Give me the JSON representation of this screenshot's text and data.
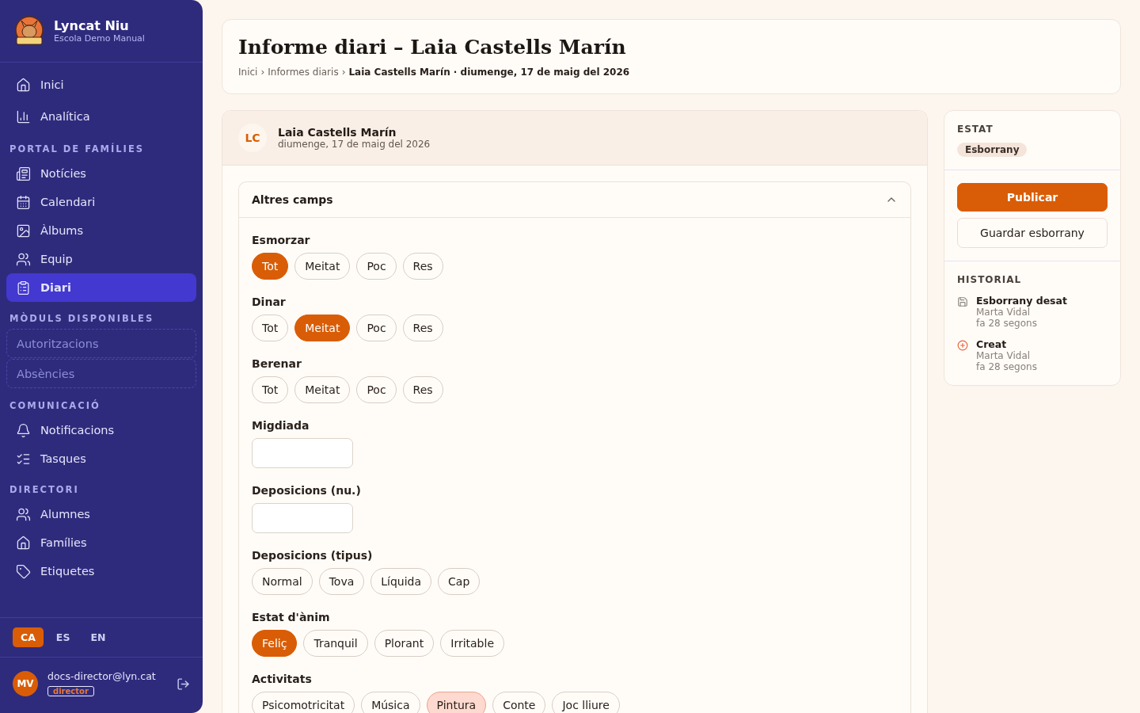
{
  "brand": {
    "name": "Lyncat Niu",
    "school": "Escola Demo Manual"
  },
  "sidebar": {
    "sections": [
      {
        "items": [
          {
            "label": "Inici",
            "selected": false,
            "kind": "link"
          },
          {
            "label": "Analítica",
            "selected": false,
            "kind": "link"
          }
        ]
      },
      {
        "title": "PORTAL DE FAMÍLIES",
        "items": [
          {
            "label": "Notícies",
            "selected": false,
            "kind": "link"
          },
          {
            "label": "Calendari",
            "selected": false,
            "kind": "link"
          },
          {
            "label": "Àlbums",
            "selected": false,
            "kind": "link"
          },
          {
            "label": "Equip",
            "selected": false,
            "kind": "link"
          },
          {
            "label": "Diari",
            "selected": true,
            "kind": "link"
          }
        ]
      },
      {
        "title": "MÒDULS DISPONIBLES",
        "items": [
          {
            "label": "Autoritzacions",
            "selected": false,
            "kind": "available"
          },
          {
            "label": "Absències",
            "selected": false,
            "kind": "available"
          }
        ]
      },
      {
        "title": "COMUNICACIÓ",
        "items": [
          {
            "label": "Notificacions",
            "selected": false,
            "kind": "link"
          },
          {
            "label": "Tasques",
            "selected": false,
            "kind": "link"
          }
        ]
      },
      {
        "title": "DIRECTORI",
        "items": [
          {
            "label": "Alumnes",
            "selected": false,
            "kind": "link"
          },
          {
            "label": "Famílies",
            "selected": false,
            "kind": "link"
          },
          {
            "label": "Etiquetes",
            "selected": false,
            "kind": "link"
          }
        ]
      }
    ],
    "languages": [
      {
        "label": "CA",
        "selected": true
      },
      {
        "label": "ES",
        "selected": false
      },
      {
        "label": "EN",
        "selected": false
      }
    ],
    "user": {
      "initials": "MV",
      "email": "docs-director@lyn.cat",
      "role": "director"
    }
  },
  "header": {
    "title": "Informe diari – Laia Castells Marín",
    "breadcrumbs": [
      {
        "label": "Inici",
        "separator": "›"
      },
      {
        "label": "Informes diaris",
        "separator": "›"
      }
    ],
    "current": "Laia Castells Marín · diumenge, 17 de maig del 2026"
  },
  "student": {
    "initials": "LC",
    "name": "Laia Castells Marín",
    "date": "diumenge, 17 de maig del 2026"
  },
  "section": {
    "title": "Altres camps",
    "expanded": true,
    "fields": [
      {
        "label": "Esmorzar",
        "kind": "choice",
        "options": [
          {
            "label": "Tot",
            "selected": true
          },
          {
            "label": "Meitat",
            "selected": false
          },
          {
            "label": "Poc",
            "selected": false
          },
          {
            "label": "Res",
            "selected": false
          }
        ]
      },
      {
        "label": "Dinar",
        "kind": "choice",
        "options": [
          {
            "label": "Tot",
            "selected": false
          },
          {
            "label": "Meitat",
            "selected": true
          },
          {
            "label": "Poc",
            "selected": false
          },
          {
            "label": "Res",
            "selected": false
          }
        ]
      },
      {
        "label": "Berenar",
        "kind": "choice",
        "options": [
          {
            "label": "Tot",
            "selected": false
          },
          {
            "label": "Meitat",
            "selected": false
          },
          {
            "label": "Poc",
            "selected": false
          },
          {
            "label": "Res",
            "selected": false
          }
        ]
      },
      {
        "label": "Migdiada",
        "kind": "input"
      },
      {
        "label": "Deposicions (nu.)",
        "kind": "input"
      },
      {
        "label": "Deposicions (tipus)",
        "kind": "choice",
        "options": [
          {
            "label": "Normal",
            "selected": false
          },
          {
            "label": "Tova",
            "selected": false
          },
          {
            "label": "Líquida",
            "selected": false
          },
          {
            "label": "Cap",
            "selected": false
          }
        ]
      },
      {
        "label": "Estat d'ànim",
        "kind": "choice",
        "options": [
          {
            "label": "Feliç",
            "selected": true
          },
          {
            "label": "Tranquil",
            "selected": false
          },
          {
            "label": "Plorant",
            "selected": false
          },
          {
            "label": "Irritable",
            "selected": false
          }
        ]
      },
      {
        "label": "Activitats",
        "kind": "multi",
        "options": [
          {
            "label": "Psicomotricitat",
            "selected": false
          },
          {
            "label": "Música",
            "selected": false
          },
          {
            "label": "Pintura",
            "selected": true
          },
          {
            "label": "Conte",
            "selected": false
          },
          {
            "label": "Joc lliure",
            "selected": false
          }
        ]
      }
    ]
  },
  "status": {
    "title": "ESTAT",
    "badge": "Esborrany",
    "publish": "Publicar",
    "save": "Guardar esborrany"
  },
  "history": {
    "title": "HISTORIAL",
    "entries": [
      {
        "kind": "saved",
        "action": "Esborrany desat",
        "author": "Marta Vidal",
        "time": "fa 28 segons"
      },
      {
        "kind": "created",
        "action": "Creat",
        "author": "Marta Vidal",
        "time": "fa 28 segons"
      }
    ]
  }
}
